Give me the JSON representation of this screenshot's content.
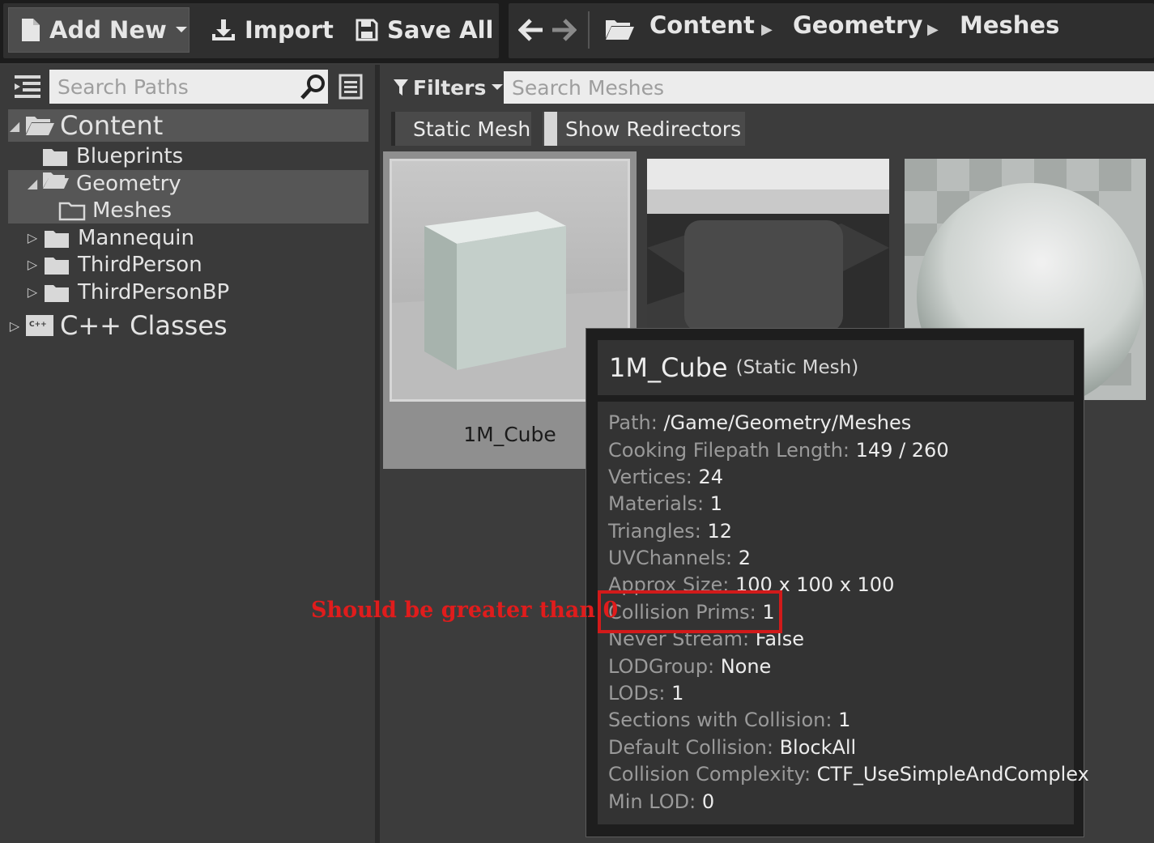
{
  "toolbar": {
    "add_new_label": "Add New",
    "import_label": "Import",
    "save_all_label": "Save All"
  },
  "breadcrumb": [
    "Content",
    "Geometry",
    "Meshes"
  ],
  "sidebar": {
    "search_placeholder": "Search Paths",
    "tree": [
      {
        "label": "Content",
        "arrow": "◢",
        "selected": true
      },
      {
        "label": "Blueprints",
        "arrow": ""
      },
      {
        "label": "Geometry",
        "arrow": "◢",
        "selected": true
      },
      {
        "label": "Meshes",
        "arrow": "",
        "selected": true
      },
      {
        "label": "Mannequin",
        "arrow": "▷"
      },
      {
        "label": "ThirdPerson",
        "arrow": "▷"
      },
      {
        "label": "ThirdPersonBP",
        "arrow": "▷"
      },
      {
        "label": "C++ Classes",
        "arrow": "▷",
        "badge": "C++"
      }
    ]
  },
  "content": {
    "filters_label": "Filters",
    "search_placeholder": "Search Meshes",
    "chips": [
      "Static Mesh",
      "Show Redirectors"
    ],
    "assets": [
      "1M_Cube"
    ]
  },
  "tooltip": {
    "name": "1M_Cube",
    "type": "(Static Mesh)",
    "rows": [
      {
        "key": "Path:",
        "value": "/Game/Geometry/Meshes"
      },
      {
        "key": "Cooking Filepath Length:",
        "value": "149 / 260"
      },
      {
        "key": "Vertices:",
        "value": "24"
      },
      {
        "key": "Materials:",
        "value": "1"
      },
      {
        "key": "Triangles:",
        "value": "12"
      },
      {
        "key": "UVChannels:",
        "value": "2"
      },
      {
        "key": "Approx Size:",
        "value": "100 x 100 x 100"
      },
      {
        "key": "Collision Prims:",
        "value": "1"
      },
      {
        "key": "Never Stream:",
        "value": "False"
      },
      {
        "key": "LODGroup:",
        "value": "None"
      },
      {
        "key": "LODs:",
        "value": "1"
      },
      {
        "key": "Sections with Collision:",
        "value": "1"
      },
      {
        "key": "Default Collision:",
        "value": "BlockAll"
      },
      {
        "key": "Collision Complexity:",
        "value": "CTF_UseSimpleAndComplex"
      },
      {
        "key": "Min LOD:",
        "value": "0"
      }
    ]
  },
  "annotation": {
    "text": "Should be greater than 0",
    "color": "#d21a1a"
  }
}
